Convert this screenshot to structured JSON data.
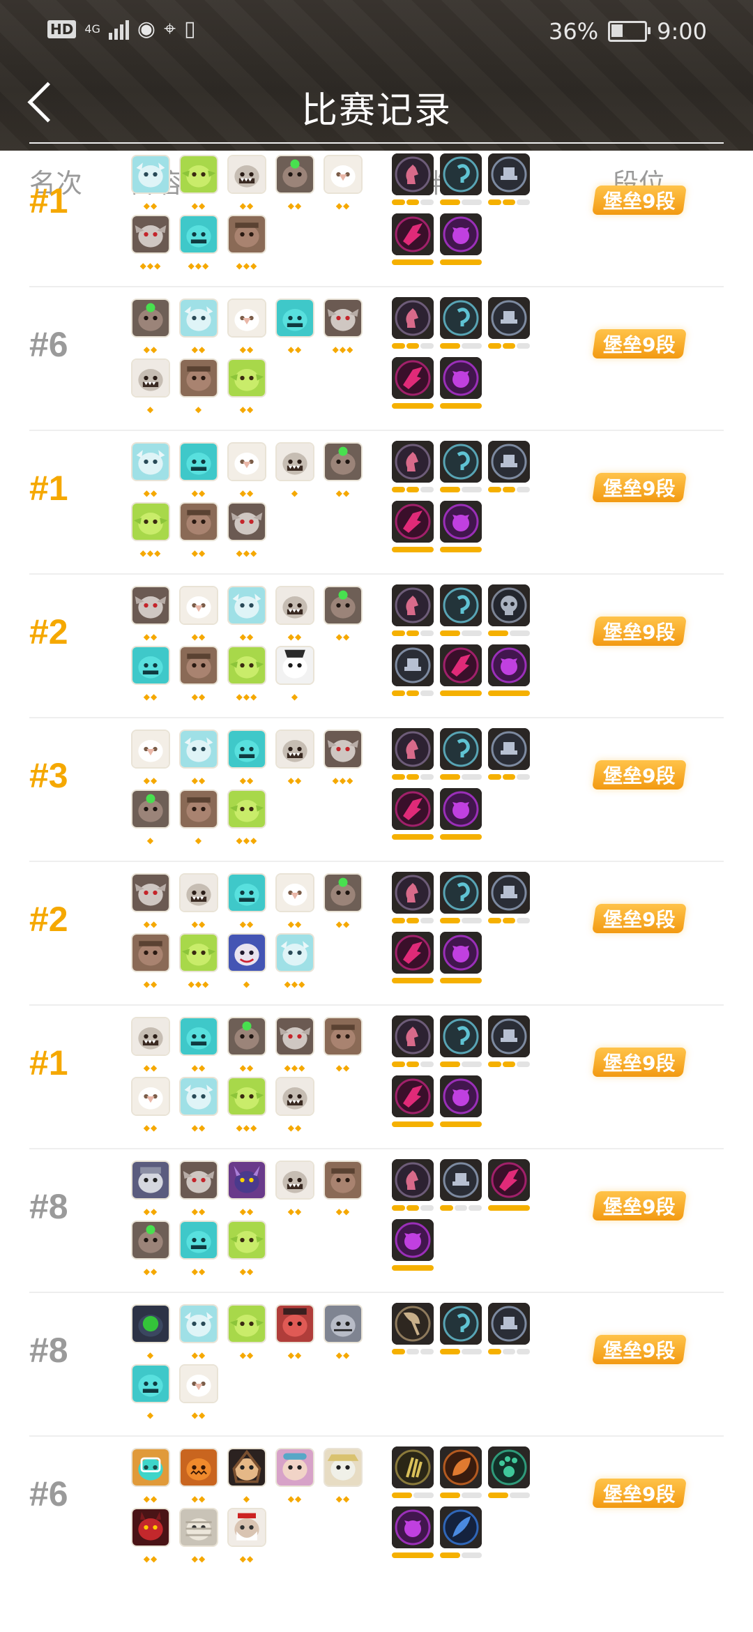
{
  "status": {
    "left_icons": [
      "hd-icon",
      "4g-signal-icon",
      "eye-icon",
      "location-icon",
      "vibrate-icon"
    ],
    "network": "4G",
    "battery": "36%",
    "time": "9:00"
  },
  "header": {
    "title": "比赛记录",
    "back_icon": "chevron-left-icon"
  },
  "columns": {
    "rank": "名次",
    "lineup": "阵容",
    "bonds": "羁绊",
    "tier": "段位"
  },
  "colors": {
    "gold": "#f5a800",
    "gray": "#9a9a9a",
    "bar": "#f5b000"
  },
  "matches": [
    {
      "rank": "#1",
      "top": true,
      "tier": "堡垒9段",
      "heroes": [
        {
          "t": "yeti",
          "s": 2
        },
        {
          "t": "goblin",
          "s": 2
        },
        {
          "t": "orc",
          "s": 2
        },
        {
          "t": "ogre",
          "s": 2
        },
        {
          "t": "yak",
          "s": 2
        },
        {
          "t": "vamp",
          "s": 3
        },
        {
          "t": "golem",
          "s": 3
        },
        {
          "t": "monk",
          "s": 3
        }
      ],
      "bonds": [
        {
          "t": "knight",
          "l": 2,
          "m": 3
        },
        {
          "t": "hook",
          "l": 1,
          "m": 2
        },
        {
          "t": "seat",
          "l": 2,
          "m": 3
        },
        {
          "t": "bat",
          "l": 1,
          "m": 1
        },
        {
          "t": "demon",
          "l": 1,
          "m": 1
        }
      ]
    },
    {
      "rank": "#6",
      "top": false,
      "tier": "堡垒9段",
      "heroes": [
        {
          "t": "ogre",
          "s": 2
        },
        {
          "t": "yeti",
          "s": 2
        },
        {
          "t": "yak",
          "s": 2
        },
        {
          "t": "golem",
          "s": 2
        },
        {
          "t": "vamp",
          "s": 3
        },
        {
          "t": "orc",
          "s": 1
        },
        {
          "t": "monk",
          "s": 1
        },
        {
          "t": "goblin",
          "s": 2
        }
      ],
      "bonds": [
        {
          "t": "knight",
          "l": 2,
          "m": 3
        },
        {
          "t": "hook",
          "l": 1,
          "m": 2
        },
        {
          "t": "seat",
          "l": 2,
          "m": 3
        },
        {
          "t": "bat",
          "l": 1,
          "m": 1
        },
        {
          "t": "demon",
          "l": 1,
          "m": 1
        }
      ]
    },
    {
      "rank": "#1",
      "top": true,
      "tier": "堡垒9段",
      "heroes": [
        {
          "t": "yeti",
          "s": 2
        },
        {
          "t": "golem",
          "s": 2
        },
        {
          "t": "yak",
          "s": 2
        },
        {
          "t": "orc",
          "s": 1
        },
        {
          "t": "ogre",
          "s": 2
        },
        {
          "t": "goblin",
          "s": 3
        },
        {
          "t": "monk",
          "s": 2
        },
        {
          "t": "vamp",
          "s": 3
        }
      ],
      "bonds": [
        {
          "t": "knight",
          "l": 2,
          "m": 3
        },
        {
          "t": "hook",
          "l": 1,
          "m": 2
        },
        {
          "t": "seat",
          "l": 2,
          "m": 3
        },
        {
          "t": "bat",
          "l": 1,
          "m": 1
        },
        {
          "t": "demon",
          "l": 1,
          "m": 1
        }
      ]
    },
    {
      "rank": "#2",
      "top": true,
      "tier": "堡垒9段",
      "heroes": [
        {
          "t": "vamp",
          "s": 2
        },
        {
          "t": "yak",
          "s": 2
        },
        {
          "t": "yeti",
          "s": 2
        },
        {
          "t": "orc",
          "s": 2
        },
        {
          "t": "ogre",
          "s": 2
        },
        {
          "t": "golem",
          "s": 2
        },
        {
          "t": "monk",
          "s": 2
        },
        {
          "t": "goblin",
          "s": 3
        },
        {
          "t": "panda",
          "s": 1
        }
      ],
      "bonds": [
        {
          "t": "knight",
          "l": 2,
          "m": 3
        },
        {
          "t": "hook",
          "l": 1,
          "m": 2
        },
        {
          "t": "skull",
          "l": 1,
          "m": 2
        },
        {
          "t": "seat",
          "l": 2,
          "m": 3
        },
        {
          "t": "bat",
          "l": 1,
          "m": 1
        },
        {
          "t": "demon",
          "l": 1,
          "m": 1
        }
      ]
    },
    {
      "rank": "#3",
      "top": true,
      "tier": "堡垒9段",
      "heroes": [
        {
          "t": "yak",
          "s": 2
        },
        {
          "t": "yeti",
          "s": 2
        },
        {
          "t": "golem",
          "s": 2
        },
        {
          "t": "orc",
          "s": 2
        },
        {
          "t": "vamp",
          "s": 3
        },
        {
          "t": "ogre",
          "s": 1
        },
        {
          "t": "monk",
          "s": 1
        },
        {
          "t": "goblin",
          "s": 3
        }
      ],
      "bonds": [
        {
          "t": "knight",
          "l": 2,
          "m": 3
        },
        {
          "t": "hook",
          "l": 1,
          "m": 2
        },
        {
          "t": "seat",
          "l": 2,
          "m": 3
        },
        {
          "t": "bat",
          "l": 1,
          "m": 1
        },
        {
          "t": "demon",
          "l": 1,
          "m": 1
        }
      ]
    },
    {
      "rank": "#2",
      "top": true,
      "tier": "堡垒9段",
      "heroes": [
        {
          "t": "vamp",
          "s": 2
        },
        {
          "t": "orc",
          "s": 2
        },
        {
          "t": "golem",
          "s": 2
        },
        {
          "t": "yak",
          "s": 2
        },
        {
          "t": "ogre",
          "s": 2
        },
        {
          "t": "monk",
          "s": 2
        },
        {
          "t": "goblin",
          "s": 3
        },
        {
          "t": "clown",
          "s": 1
        },
        {
          "t": "yeti",
          "s": 3
        }
      ],
      "bonds": [
        {
          "t": "knight",
          "l": 2,
          "m": 3
        },
        {
          "t": "hook",
          "l": 1,
          "m": 2
        },
        {
          "t": "seat",
          "l": 2,
          "m": 3
        },
        {
          "t": "bat",
          "l": 1,
          "m": 1
        },
        {
          "t": "demon",
          "l": 1,
          "m": 1
        }
      ]
    },
    {
      "rank": "#1",
      "top": true,
      "tier": "堡垒9段",
      "heroes": [
        {
          "t": "orc",
          "s": 2
        },
        {
          "t": "golem",
          "s": 2
        },
        {
          "t": "ogre",
          "s": 2
        },
        {
          "t": "vamp",
          "s": 3
        },
        {
          "t": "monk",
          "s": 2
        },
        {
          "t": "yak",
          "s": 2
        },
        {
          "t": "yeti",
          "s": 2
        },
        {
          "t": "goblin",
          "s": 3
        },
        {
          "t": "orc",
          "s": 2
        }
      ],
      "bonds": [
        {
          "t": "knight",
          "l": 2,
          "m": 3
        },
        {
          "t": "hook",
          "l": 1,
          "m": 2
        },
        {
          "t": "seat",
          "l": 2,
          "m": 3
        },
        {
          "t": "bat",
          "l": 1,
          "m": 1
        },
        {
          "t": "demon",
          "l": 1,
          "m": 1
        }
      ]
    },
    {
      "rank": "#8",
      "top": false,
      "tier": "堡垒9段",
      "heroes": [
        {
          "t": "knightm",
          "s": 2
        },
        {
          "t": "vamp",
          "s": 2
        },
        {
          "t": "demonh",
          "s": 2
        },
        {
          "t": "orc",
          "s": 2
        },
        {
          "t": "monk",
          "s": 2
        },
        {
          "t": "ogre",
          "s": 2
        },
        {
          "t": "golem",
          "s": 2
        },
        {
          "t": "goblin",
          "s": 2
        }
      ],
      "bonds": [
        {
          "t": "knight",
          "l": 2,
          "m": 3
        },
        {
          "t": "seat",
          "l": 1,
          "m": 3
        },
        {
          "t": "bat",
          "l": 1,
          "m": 1
        },
        {
          "t": "demon",
          "l": 1,
          "m": 1
        }
      ]
    },
    {
      "rank": "#8",
      "top": false,
      "tier": "堡垒9段",
      "heroes": [
        {
          "t": "robot",
          "s": 1
        },
        {
          "t": "yeti",
          "s": 2
        },
        {
          "t": "goblin",
          "s": 2
        },
        {
          "t": "redorc",
          "s": 2
        },
        {
          "t": "grey",
          "s": 2
        },
        {
          "t": "golem",
          "s": 1
        },
        {
          "t": "yak",
          "s": 2
        }
      ],
      "bonds": [
        {
          "t": "axe",
          "l": 1,
          "m": 3
        },
        {
          "t": "hook",
          "l": 1,
          "m": 2
        },
        {
          "t": "seat",
          "l": 1,
          "m": 3
        }
      ]
    },
    {
      "rank": "#6",
      "top": false,
      "tier": "堡垒9段",
      "heroes": [
        {
          "t": "tech",
          "s": 2
        },
        {
          "t": "pump",
          "s": 2
        },
        {
          "t": "hood",
          "s": 1
        },
        {
          "t": "girl",
          "s": 2
        },
        {
          "t": "wiz",
          "s": 2
        },
        {
          "t": "reddemon",
          "s": 2
        },
        {
          "t": "mummy",
          "s": 2
        },
        {
          "t": "santa",
          "s": 2
        }
      ],
      "bonds": [
        {
          "t": "claw",
          "l": 1,
          "m": 2
        },
        {
          "t": "leaf",
          "l": 1,
          "m": 2
        },
        {
          "t": "paw",
          "l": 1,
          "m": 2
        },
        {
          "t": "demon",
          "l": 1,
          "m": 1
        },
        {
          "t": "feather",
          "l": 1,
          "m": 2
        }
      ]
    }
  ]
}
